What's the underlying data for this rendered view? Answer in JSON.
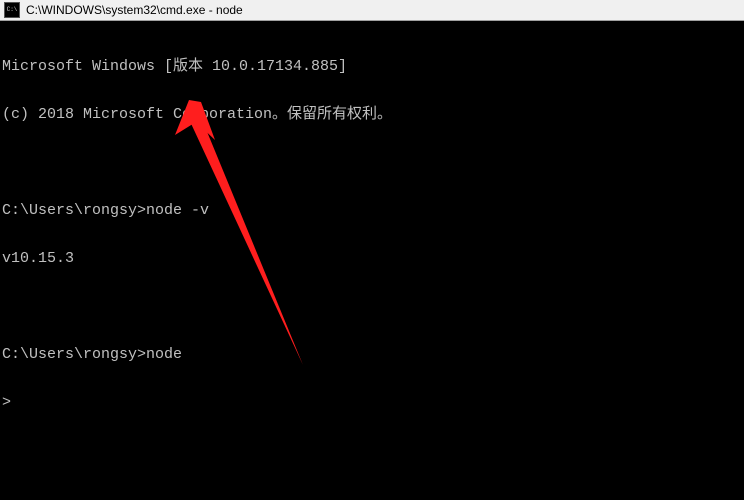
{
  "window": {
    "title": "C:\\WINDOWS\\system32\\cmd.exe - node",
    "icon_label": "C:\\"
  },
  "terminal": {
    "lines": [
      "Microsoft Windows [版本 10.0.17134.885]",
      "(c) 2018 Microsoft Corporation。保留所有权利。",
      "",
      "C:\\Users\\rongsy>node -v",
      "v10.15.3",
      "",
      "C:\\Users\\rongsy>node",
      ">"
    ]
  },
  "annotation": {
    "type": "arrow",
    "color": "#ff1e1e"
  }
}
